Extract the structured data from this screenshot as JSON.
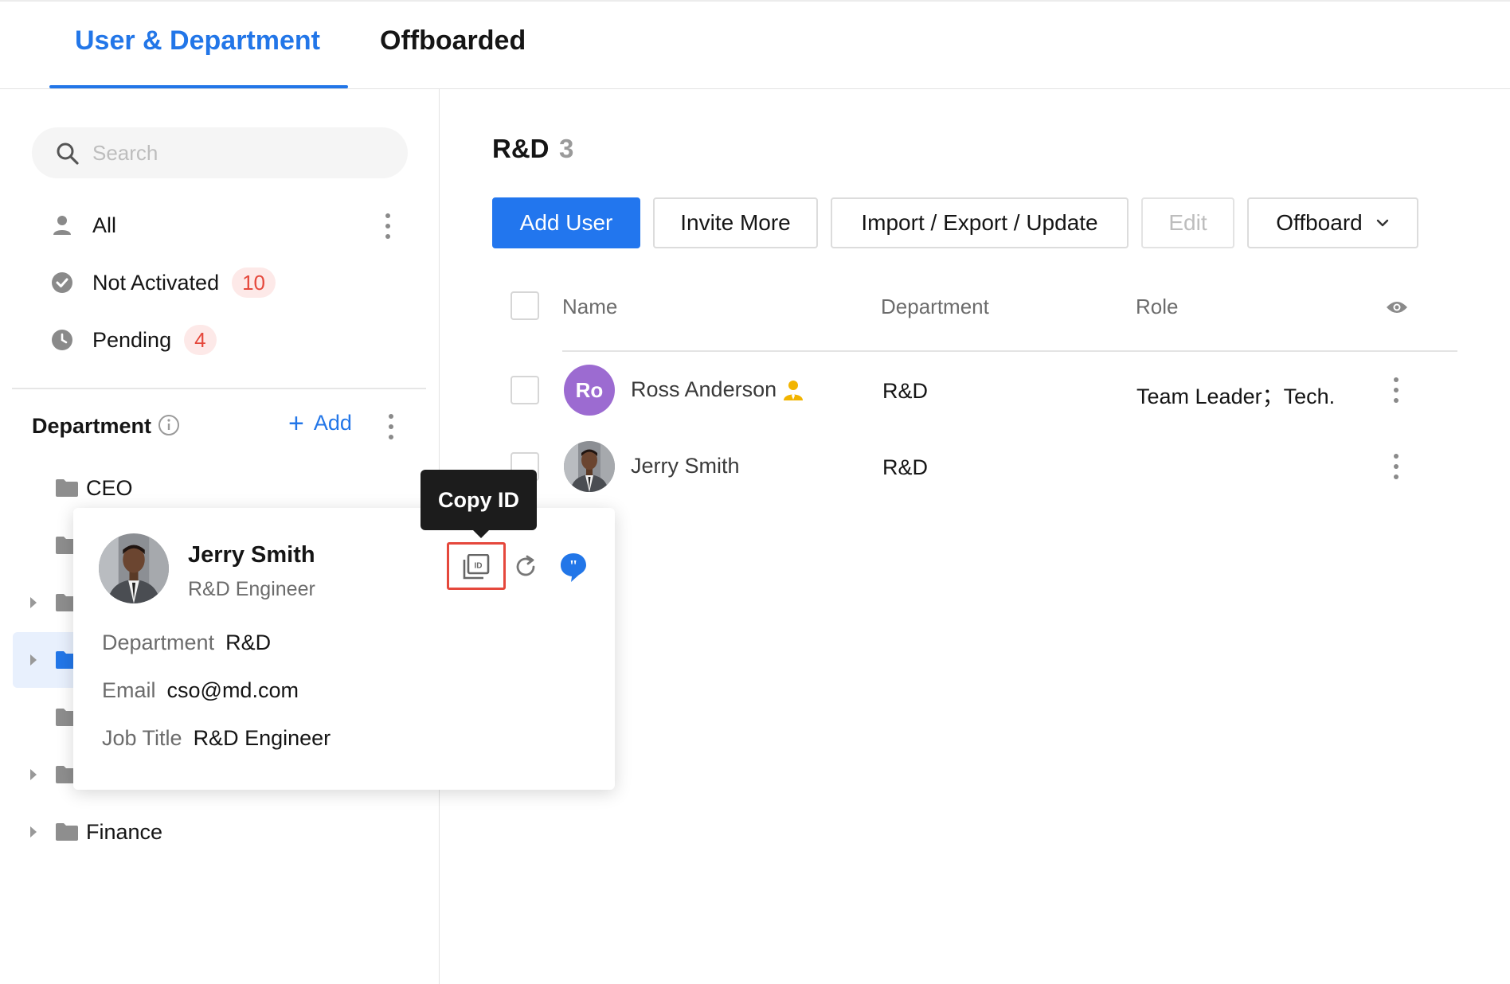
{
  "tabs": [
    {
      "label": "User & Department",
      "active": true
    },
    {
      "label": "Offboarded",
      "active": false
    }
  ],
  "sidebar": {
    "search_placeholder": "Search",
    "filters": [
      {
        "label": "All",
        "icon": "person-icon",
        "badge": ""
      },
      {
        "label": "Not Activated",
        "icon": "check-circle-icon",
        "badge": "10"
      },
      {
        "label": "Pending",
        "icon": "clock-icon",
        "badge": "4"
      }
    ],
    "department_title": "Department",
    "add_label": "Add",
    "tree": [
      {
        "label": "CEO",
        "expandable": false,
        "selected": false
      },
      {
        "label": "",
        "expandable": false,
        "selected": false
      },
      {
        "label": "",
        "expandable": true,
        "selected": false
      },
      {
        "label": "",
        "expandable": true,
        "selected": true
      },
      {
        "label": "",
        "expandable": false,
        "selected": false
      },
      {
        "label": "",
        "expandable": true,
        "selected": false
      },
      {
        "label": "Finance",
        "expandable": true,
        "selected": false
      }
    ]
  },
  "main": {
    "title": "R&D",
    "count": "3",
    "toolbar": {
      "add_user": "Add User",
      "invite_more": "Invite More",
      "import_export": "Import / Export / Update",
      "edit": "Edit",
      "offboard": "Offboard"
    },
    "columns": {
      "name": "Name",
      "department": "Department",
      "role": "Role"
    },
    "rows": [
      {
        "initials": "Ro",
        "name": "Ross Anderson",
        "department": "R&D",
        "role": "Team Leader；Tech.",
        "leader": true
      },
      {
        "initials": "",
        "name": "Jerry Smith",
        "department": "R&D",
        "role": "",
        "leader": false
      }
    ]
  },
  "card": {
    "name": "Jerry Smith",
    "subtitle": "R&D Engineer",
    "fields": [
      {
        "key": "Department",
        "value": "R&D"
      },
      {
        "key": "Email",
        "value": "cso@md.com"
      },
      {
        "key": "Job Title",
        "value": "R&D Engineer"
      }
    ],
    "tooltip": "Copy ID"
  },
  "colors": {
    "accent": "#2276e8",
    "badge_text": "#e5483c",
    "badge_bg": "#fde9e8",
    "avatar_ro": "#9c6bd1",
    "leader_icon": "#f2b400"
  }
}
